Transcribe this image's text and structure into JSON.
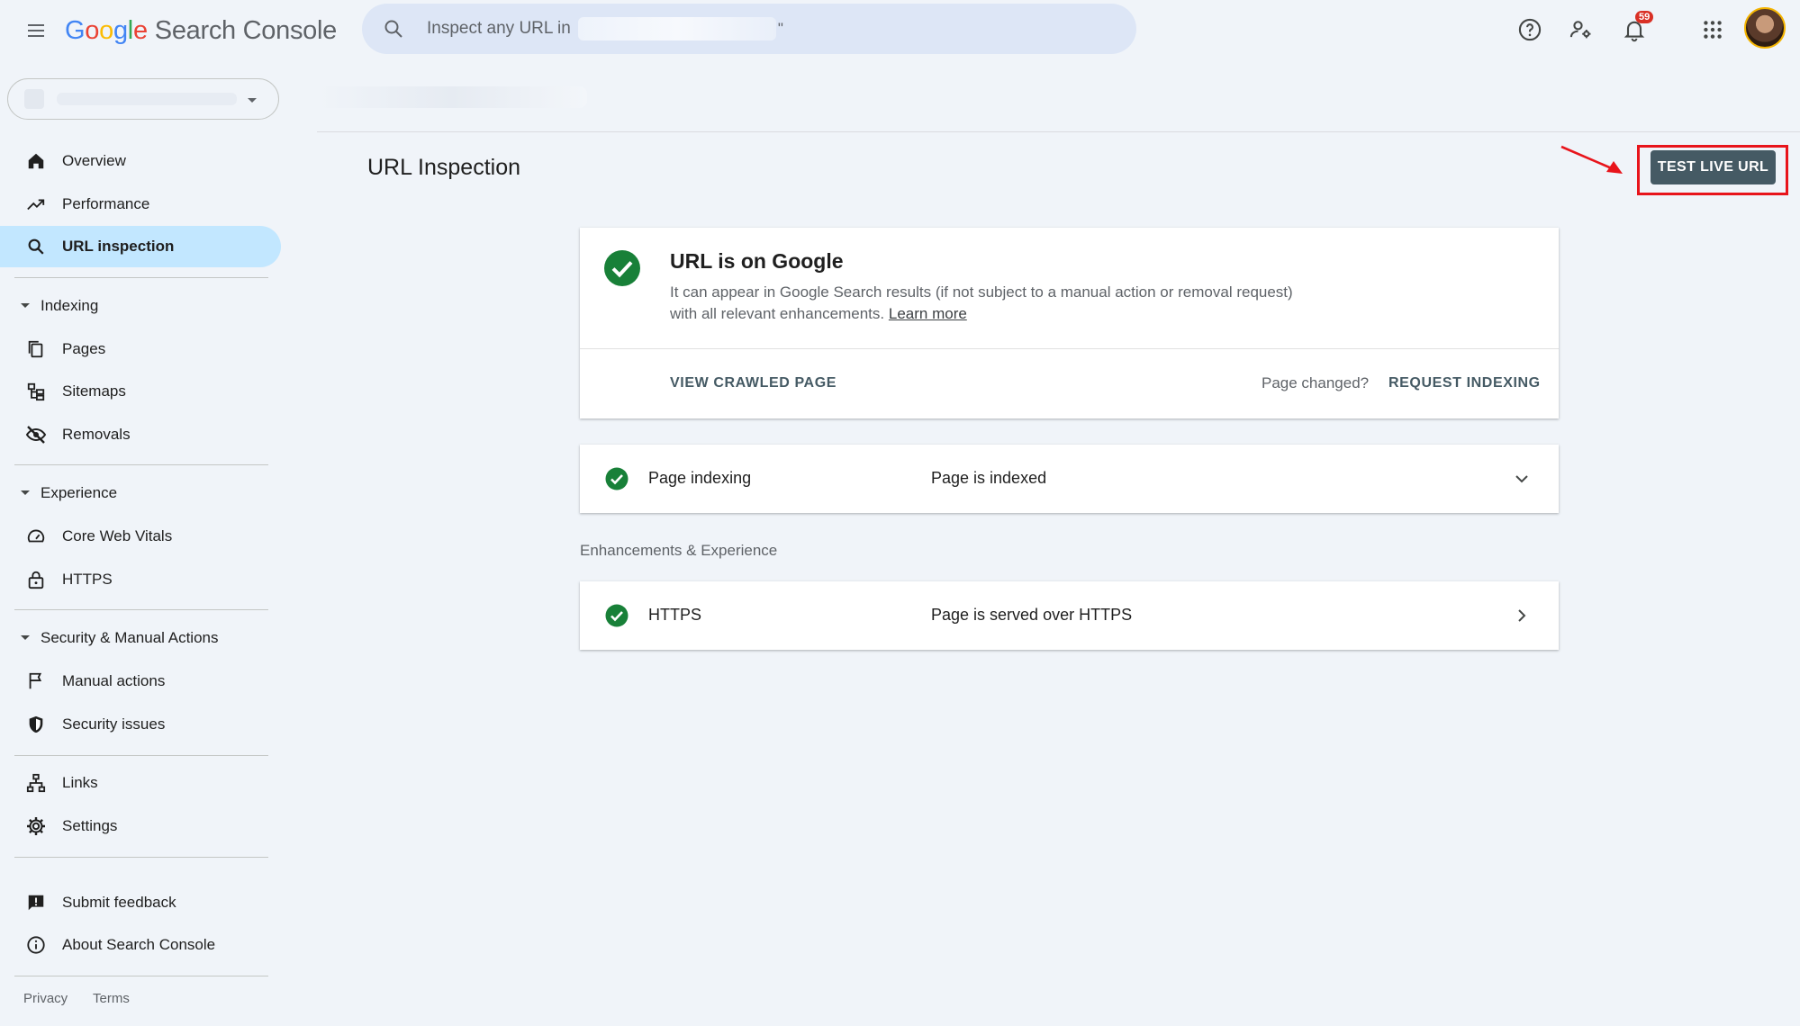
{
  "app": {
    "logo_google": [
      "G",
      "o",
      "o",
      "g",
      "l",
      "e"
    ],
    "product_name": "Search Console"
  },
  "search": {
    "placeholder": "Inspect any URL in",
    "quote_mark": "\""
  },
  "notifications": {
    "count": "59"
  },
  "sidebar": {
    "items": [
      {
        "label": "Overview",
        "icon": "home-icon"
      },
      {
        "label": "Performance",
        "icon": "trending-up-icon"
      },
      {
        "label": "URL inspection",
        "icon": "search-icon",
        "active": true
      }
    ],
    "sections": [
      {
        "label": "Indexing",
        "items": [
          {
            "label": "Pages",
            "icon": "pages-icon"
          },
          {
            "label": "Sitemaps",
            "icon": "sitemap-icon"
          },
          {
            "label": "Removals",
            "icon": "visibility-off-icon"
          }
        ]
      },
      {
        "label": "Experience",
        "items": [
          {
            "label": "Core Web Vitals",
            "icon": "speed-icon"
          },
          {
            "label": "HTTPS",
            "icon": "lock-icon"
          }
        ]
      },
      {
        "label": "Security & Manual Actions",
        "items": [
          {
            "label": "Manual actions",
            "icon": "flag-icon"
          },
          {
            "label": "Security issues",
            "icon": "shield-icon"
          }
        ]
      }
    ],
    "extra": [
      {
        "label": "Links",
        "icon": "links-icon"
      },
      {
        "label": "Settings",
        "icon": "gear-icon"
      }
    ],
    "bottom": [
      {
        "label": "Submit feedback",
        "icon": "feedback-icon"
      },
      {
        "label": "About Search Console",
        "icon": "info-icon"
      }
    ],
    "footer": {
      "privacy": "Privacy",
      "terms": "Terms"
    }
  },
  "main": {
    "page_title": "URL Inspection",
    "test_live_url": "TEST LIVE URL",
    "status_card": {
      "title": "URL is on Google",
      "description": "It can appear in Google Search results (if not subject to a manual action or removal request) with all relevant enhancements.",
      "learn_more": "Learn more",
      "view_crawled": "VIEW CRAWLED PAGE",
      "page_changed": "Page changed?",
      "request_indexing": "REQUEST INDEXING"
    },
    "indexing_row": {
      "name": "Page indexing",
      "value": "Page is indexed"
    },
    "enhancements_heading": "Enhancements & Experience",
    "https_row": {
      "name": "HTTPS",
      "value": "Page is served over HTTPS"
    }
  },
  "colors": {
    "background": "#f0f4f9",
    "active_nav": "#c2e7ff",
    "success_green": "#188038",
    "button_dark": "#455a64",
    "annotation_red": "#e8141b"
  }
}
